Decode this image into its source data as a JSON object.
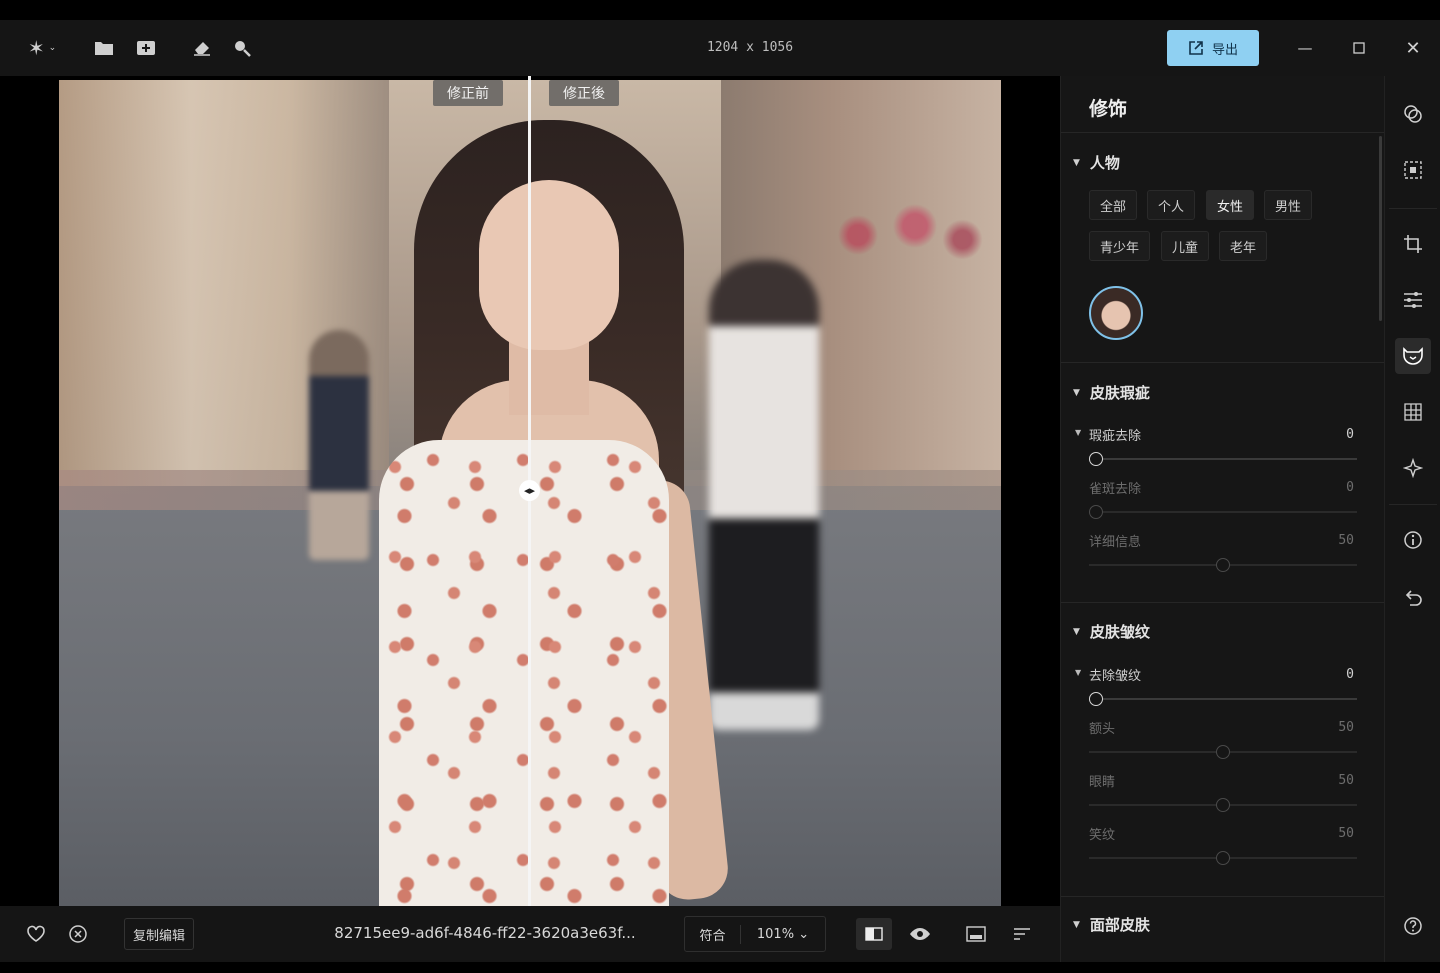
{
  "toolbar": {
    "doc_size": "1204 x 1056",
    "export_label": "导出",
    "icons": [
      "sparkle-icon",
      "folder-icon",
      "add-image-icon",
      "eraser-icon",
      "search-icon"
    ]
  },
  "compare": {
    "before_label": "修正前",
    "after_label": "修正後"
  },
  "bottom": {
    "copy_edit_label": "复制编辑",
    "filename": "82715ee9-ad6f-4846-ff22-3620a3e63f...",
    "fit_label": "符合",
    "zoom_label": "101% ⌄"
  },
  "panel": {
    "title": "修饰",
    "people": {
      "heading": "人物",
      "chips": [
        "全部",
        "个人",
        "女性",
        "男性",
        "青少年",
        "儿童",
        "老年"
      ],
      "active_chip": "女性"
    },
    "blemish": {
      "heading": "皮肤瑕疵",
      "remove": {
        "label": "瑕疵去除",
        "value": "0",
        "level": 0
      },
      "freckle": {
        "label": "雀斑去除",
        "value": "0",
        "level": 0
      },
      "detail": {
        "label": "详细信息",
        "value": "50",
        "level": 0.5
      }
    },
    "wrinkle": {
      "heading": "皮肤皱纹",
      "remove": {
        "label": "去除皱纹",
        "value": "0",
        "level": 0
      },
      "forehead": {
        "label": "额头",
        "value": "50",
        "level": 0.5
      },
      "eyes": {
        "label": "眼睛",
        "value": "50",
        "level": 0.5
      },
      "smile": {
        "label": "笑纹",
        "value": "50",
        "level": 0.5
      }
    },
    "face_skin": {
      "heading": "面部皮肤"
    }
  },
  "colors": {
    "accent": "#8fd0f2",
    "bg": "#151515"
  }
}
